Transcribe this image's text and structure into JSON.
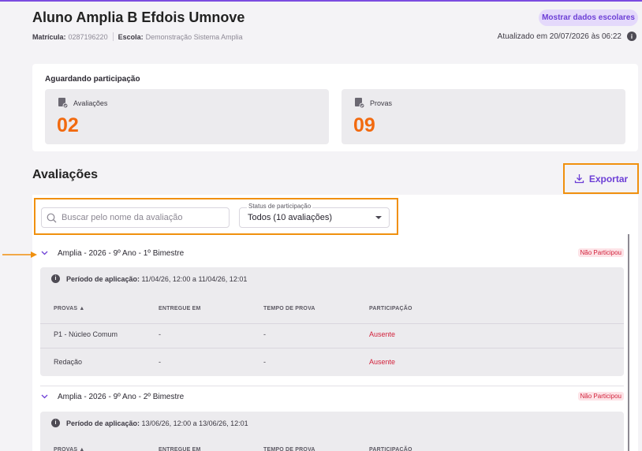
{
  "student": {
    "name": "Aluno Amplia B Efdois Umnove",
    "matricula_label": "Matrícula:",
    "matricula_value": "0287196220",
    "escola_label": "Escola:",
    "escola_value": "Demonstração Sistema Amplia",
    "show_button": "Mostrar dados escolares",
    "updated": "Atualizado em 20/07/2026 às 06:22"
  },
  "waiting": {
    "title": "Aguardando participação",
    "stats": [
      {
        "label": "Avaliações",
        "value": "02"
      },
      {
        "label": "Provas",
        "value": "09"
      }
    ]
  },
  "section": {
    "title": "Avaliações",
    "export_label": "Exportar"
  },
  "filters": {
    "search_placeholder": "Buscar pelo nome da avaliação",
    "status_label": "Status de participação",
    "status_value": "Todos (10 avaliações)"
  },
  "table_headers": [
    "PROVAS",
    "ENTREGUE EM",
    "TEMPO DE PROVA",
    "PARTICIPAÇÃO"
  ],
  "groups": [
    {
      "title": "Amplia - 2026 - 9º Ano - 1º Bimestre",
      "badge": "Não Participou",
      "period_label": "Período de aplicação:",
      "period_value": "11/04/26, 12:00 a 11/04/26, 12:01",
      "rows": [
        {
          "prova": "P1 - Núcleo Comum",
          "entregue": "-",
          "tempo": "-",
          "participacao": "Ausente"
        },
        {
          "prova": "Redação",
          "entregue": "-",
          "tempo": "-",
          "participacao": "Ausente"
        }
      ]
    },
    {
      "title": "Amplia - 2026 - 9º Ano - 2º Bimestre",
      "badge": "Não Participou",
      "period_label": "Período de aplicação:",
      "period_value": "13/06/26, 12:00 a 13/06/26, 12:01"
    }
  ],
  "colors": {
    "accent": "#6d3fd6",
    "highlight": "#f0900e",
    "stat_number": "#f26a0f",
    "absent": "#d2223c"
  }
}
